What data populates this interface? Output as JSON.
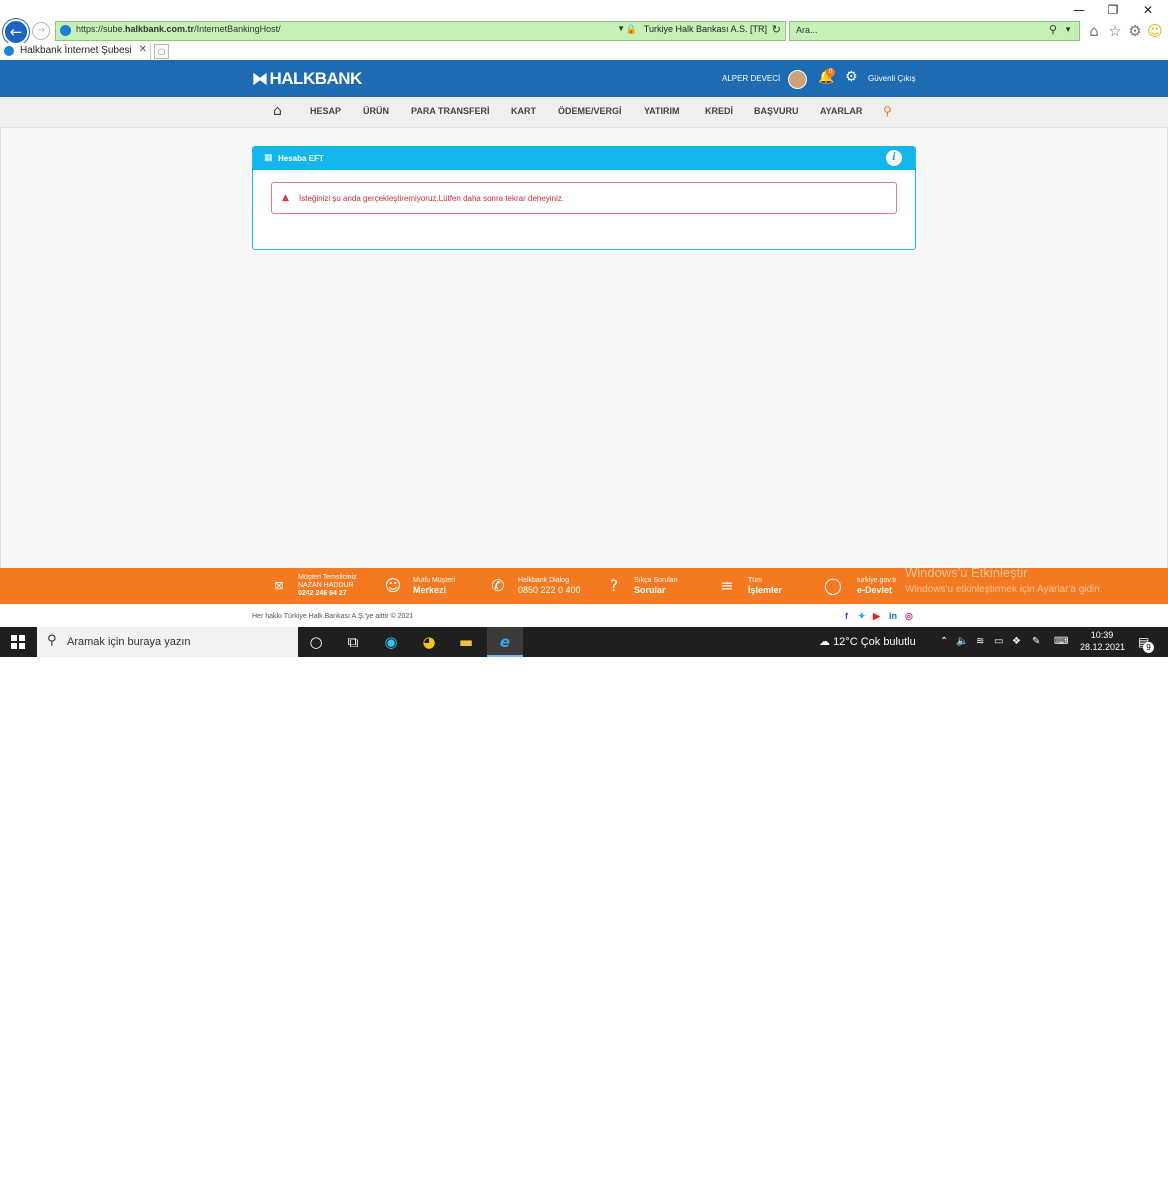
{
  "browser": {
    "url_prefix": "https://sube.",
    "url_domain": "halkbank.com.tr",
    "url_path": "/InternetBankingHost/",
    "security_label": "Turkiye Halk Bankası A.S. [TR]",
    "search_placeholder": "Ara...",
    "tab_title": "Halkbank İnternet Şubesi",
    "window_min": "—",
    "window_restore": "❐",
    "window_close": "✕"
  },
  "header": {
    "logo": "HALKBANK",
    "user_name": "ALPER DEVECİ",
    "notification_count": "0",
    "logout": "Güvenli Çıkış"
  },
  "nav": {
    "items": [
      "HESAP",
      "ÜRÜN",
      "PARA TRANSFERİ",
      "KART",
      "ÖDEME/VERGİ",
      "YATIRIM",
      "KREDİ",
      "BAŞVURU",
      "AYARLAR"
    ]
  },
  "panel": {
    "title": "Hesaba EFT",
    "info": "i",
    "alert_text": "İsteğinizi şu anda gerçekleştiremiyoruz.Lütfen daha sonra tekrar deneyiniz."
  },
  "footer": {
    "rep_label": "Müşteri Temsilciniz",
    "rep_name": "NAZAN HADDUR",
    "rep_phone": "0242 246 64 27",
    "happy_small": "Mutlu Müşteri",
    "happy_big": "Merkezi",
    "dialog_small": "Halkbank Dialog",
    "dialog_big": "0850 222 0 400",
    "faq_small": "Sıkça Sorulan",
    "faq_big": "Sorular",
    "all_small": "Tüm",
    "all_big": "İşlemler",
    "edevlet_small": "turkiye.gov.tr",
    "edevlet_big": "e-Devlet",
    "copyright": "Her hakkı Türkiye Halk Bankası A.Ş.'ye aittir © 2021",
    "watermark_title": "Windows'u Etkinleştir",
    "watermark_sub": "Windows'u etkinleştirmek için Ayarlar'a gidin."
  },
  "taskbar": {
    "search_placeholder": "Aramak için buraya yazın",
    "weather": "12°C  Çok bulutlu",
    "time": "10:39",
    "date": "28.12.2021",
    "notif_count": "9"
  },
  "colors": {
    "header_blue": "#1c6bb3",
    "panel_cyan": "#12b5ec",
    "footer_orange": "#f47920",
    "alert_red": "#c62f3d"
  }
}
